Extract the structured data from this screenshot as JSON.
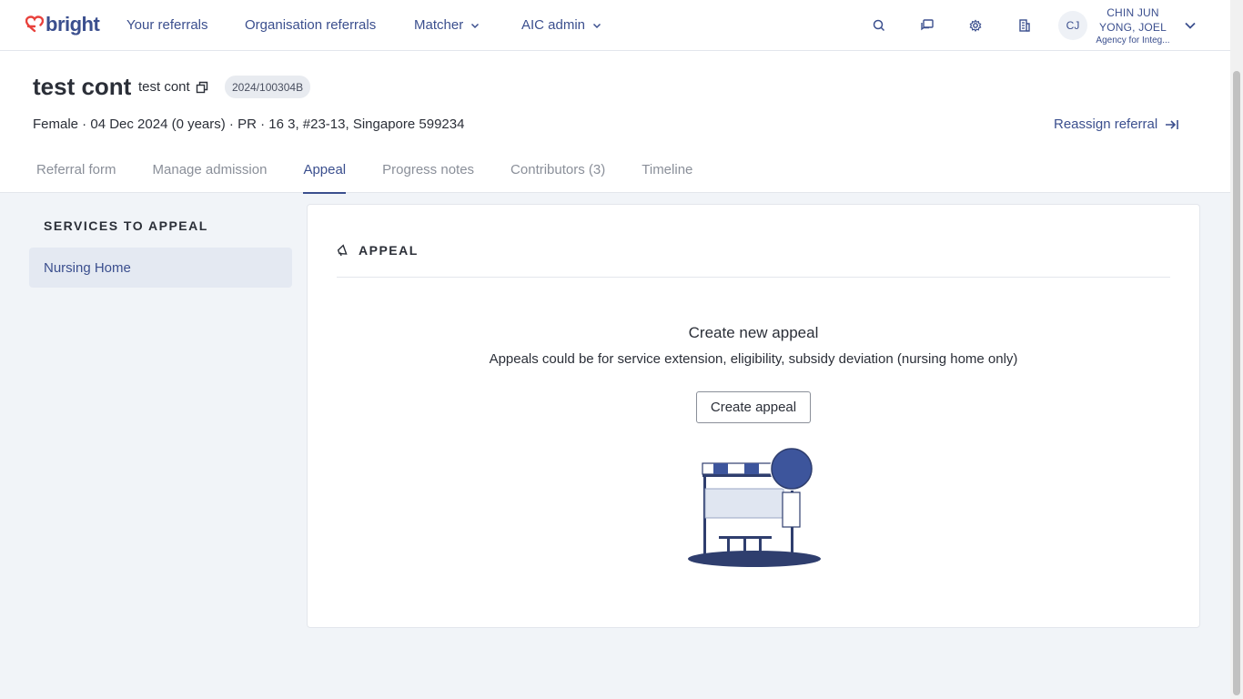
{
  "app": {
    "logo_text": "bright"
  },
  "nav": {
    "your_referrals": "Your referrals",
    "org_referrals": "Organisation referrals",
    "matcher": "Matcher",
    "aic_admin": "AIC admin"
  },
  "user": {
    "initials": "CJ",
    "name_line1": "CHIN JUN",
    "name_line2": "YONG, JOEL",
    "org": "Agency for Integ..."
  },
  "patient": {
    "name": "test cont",
    "alias": "test cont",
    "ref_id": "2024/100304B",
    "details": "Female · 04 Dec 2024 (0 years) · PR · 16 3, #23-13, Singapore 599234"
  },
  "reassign_label": "Reassign referral",
  "tabs": [
    {
      "label": "Referral form"
    },
    {
      "label": "Manage admission"
    },
    {
      "label": "Appeal"
    },
    {
      "label": "Progress notes"
    },
    {
      "label": "Contributors (3)"
    },
    {
      "label": "Timeline"
    }
  ],
  "sidebar": {
    "title": "SERVICES TO APPEAL",
    "items": [
      {
        "label": "Nursing Home"
      }
    ]
  },
  "card": {
    "title": "APPEAL",
    "empty_title": "Create new appeal",
    "empty_sub": "Appeals could be for service extension, eligibility, subsidy deviation (nursing home only)",
    "create_button": "Create appeal"
  },
  "colors": {
    "brand": "#3b4f8e",
    "logo_heart": "#e8413c"
  }
}
